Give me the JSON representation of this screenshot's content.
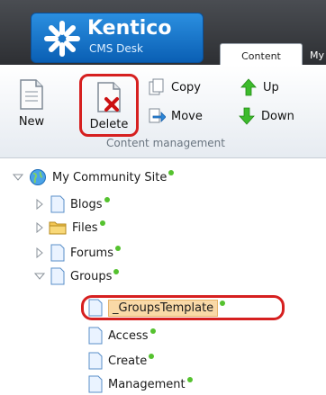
{
  "logo": {
    "brand": "Kentico",
    "product": "CMS Desk"
  },
  "tabs": [
    {
      "label": "Content",
      "active": true
    },
    {
      "label": "My",
      "active": false
    }
  ],
  "ribbon": {
    "new_label": "New",
    "delete_label": "Delete",
    "copy_label": "Copy",
    "move_label": "Move",
    "up_label": "Up",
    "down_label": "Down",
    "group_label": "Content management"
  },
  "tree": {
    "root": "My Community Site",
    "items": [
      {
        "label": "Blogs",
        "icon": "page-icon"
      },
      {
        "label": "Files",
        "icon": "folder-icon"
      },
      {
        "label": "Forums",
        "icon": "page-icon"
      },
      {
        "label": "Groups",
        "icon": "page-icon"
      },
      {
        "label": "_GroupsTemplate",
        "icon": "page-icon"
      },
      {
        "label": "Access",
        "icon": "page-icon"
      },
      {
        "label": "Create",
        "icon": "page-icon"
      },
      {
        "label": "Management",
        "icon": "page-icon"
      }
    ]
  },
  "colors": {
    "header": "#2d2f33",
    "logo": "#1677d2",
    "highlight": "#d62020",
    "status_dot": "#55c22f",
    "selected_bg": "#f9d9a7"
  }
}
